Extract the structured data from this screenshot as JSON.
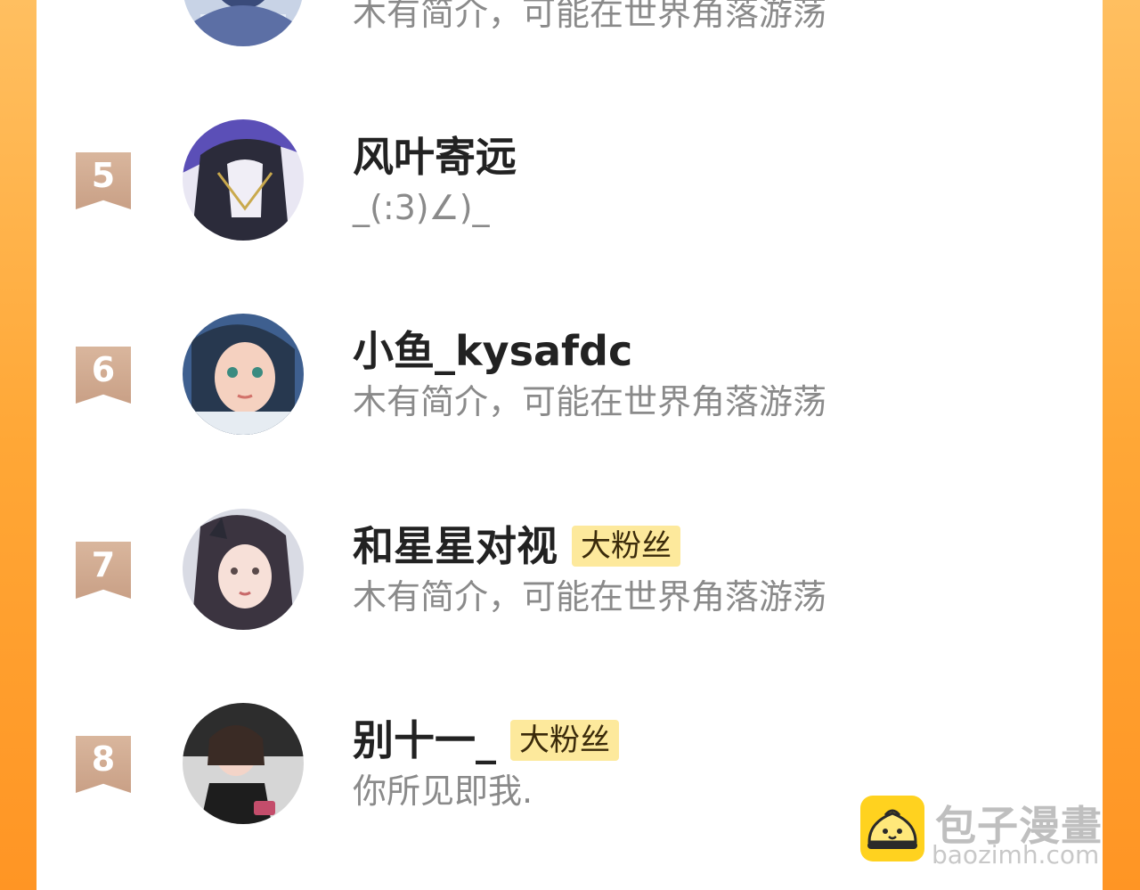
{
  "colors": {
    "background_accent": "#ffa736",
    "rank_ribbon": "#d2ab91",
    "badge_bg": "#fde99c",
    "name_text": "#222222",
    "bio_text": "#8a8a8a"
  },
  "fan_list": [
    {
      "rank": "",
      "name": "",
      "badge": "",
      "bio": "木有简介，可能在世界角落游荡",
      "avatar_icon": "user-avatar"
    },
    {
      "rank": "5",
      "name": "风叶寄远",
      "badge": "",
      "bio": "_(:3)∠)_",
      "avatar_icon": "user-avatar"
    },
    {
      "rank": "6",
      "name": "小鱼_kysafdc",
      "badge": "",
      "bio": "木有简介，可能在世界角落游荡",
      "avatar_icon": "user-avatar"
    },
    {
      "rank": "7",
      "name": "和星星对视",
      "badge": "大粉丝",
      "bio": "木有简介，可能在世界角落游荡",
      "avatar_icon": "user-avatar"
    },
    {
      "rank": "8",
      "name": "别十一_",
      "badge": "大粉丝",
      "bio": "你所见即我.",
      "avatar_icon": "user-avatar"
    }
  ],
  "watermark": {
    "title": "包子漫畫",
    "domain": "baozimh.com",
    "icon": "baozi-logo-icon"
  }
}
